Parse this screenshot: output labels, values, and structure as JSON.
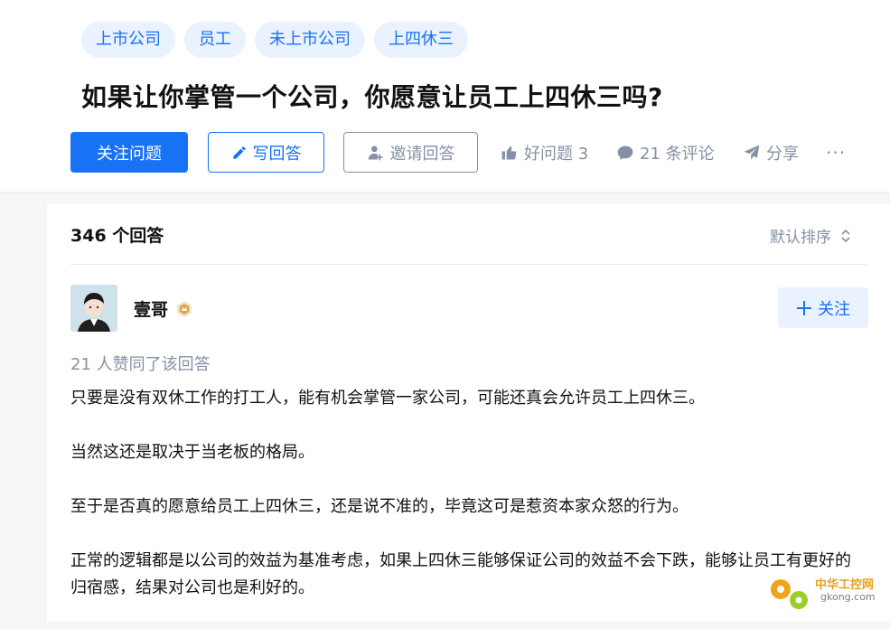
{
  "question": {
    "tags": [
      "上市公司",
      "员工",
      "未上市公司",
      "上四休三"
    ],
    "title": "如果让你掌管一个公司，你愿意让员工上四休三吗?",
    "follow_label": "关注问题",
    "write_label": "写回答",
    "invite_label": "邀请回答",
    "good_label": "好问题 3",
    "comment_label": "21 条评论",
    "share_label": "分享",
    "more_label": "···"
  },
  "answers": {
    "count_label": "346 个回答",
    "sort_label": "默认排序"
  },
  "answer": {
    "author": "壹哥",
    "follow_label": "关注",
    "votes_label": "21 人赞同了该回答",
    "paragraphs": [
      "只要是没有双休工作的打工人，能有机会掌管一家公司，可能还真会允许员工上四休三。",
      "当然这还是取决于当老板的格局。",
      "至于是否真的愿意给员工上四休三，还是说不准的，毕竟这可是惹资本家众怒的行为。",
      "正常的逻辑都是以公司的效益为基准考虑，如果上四休三能够保证公司的效益不会下跌，能够让员工有更好的归宿感，结果对公司也是利好的。"
    ]
  },
  "watermark": {
    "line1": "中华工控网",
    "line2": "gkong.com"
  },
  "colors": {
    "accent": "#1772f6",
    "muted": "#8590a6",
    "tag_bg": "#eaf2ff"
  },
  "icons": [
    "pencil-icon",
    "invite-user-icon",
    "thumb-up-icon",
    "comment-icon",
    "share-icon",
    "sort-icon",
    "plus-icon",
    "badge-icon"
  ]
}
